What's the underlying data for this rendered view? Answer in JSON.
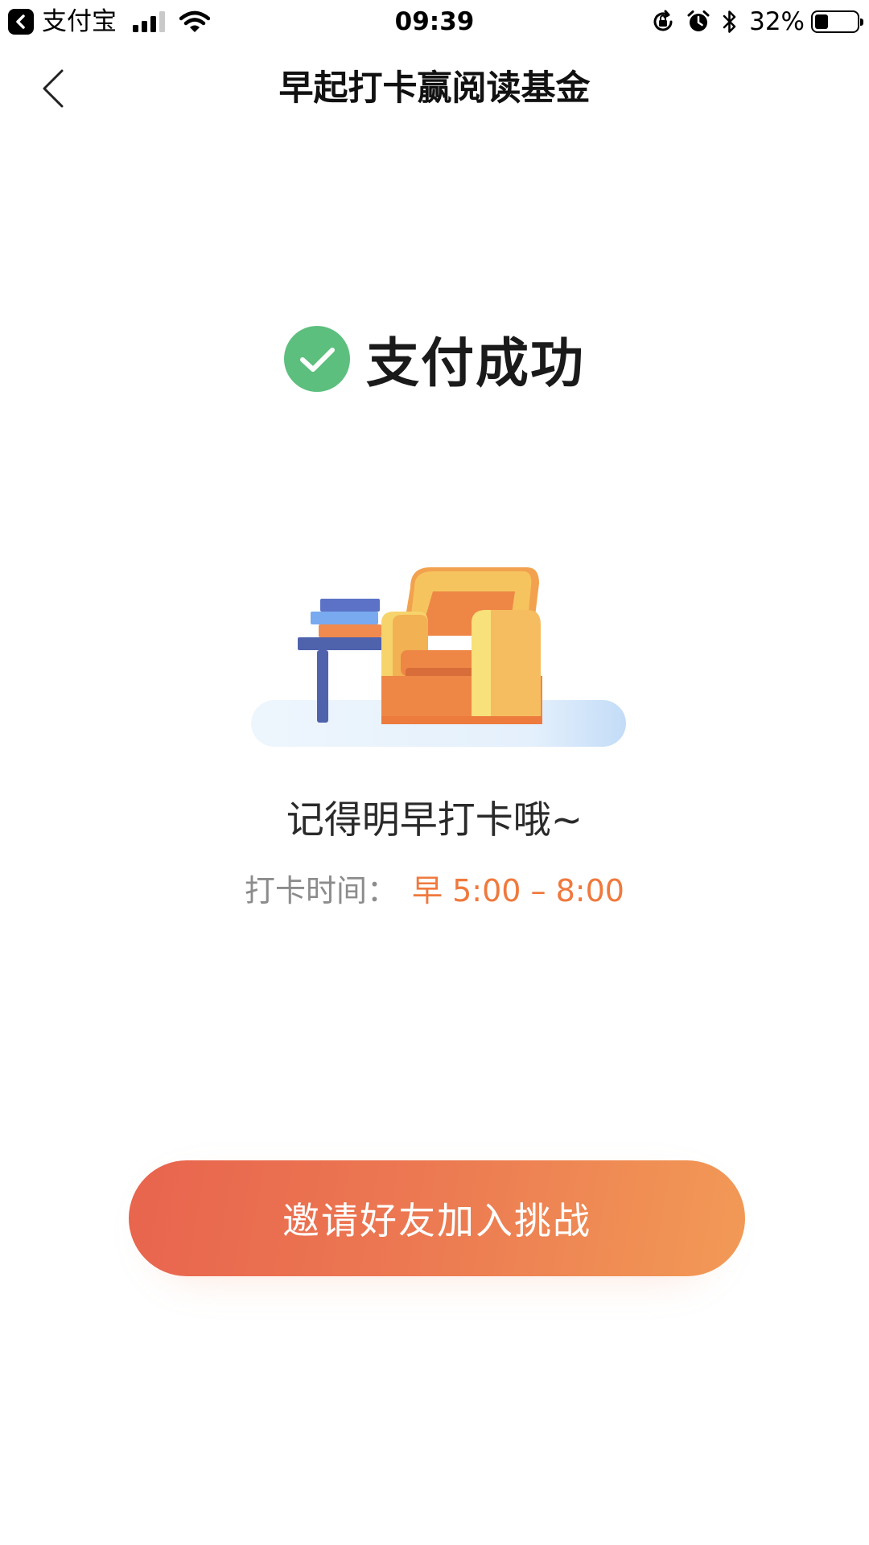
{
  "status_bar": {
    "app_name": "支付宝",
    "time": "09:39",
    "battery_percent": "32%",
    "battery_level": 0.32
  },
  "nav": {
    "title": "早起打卡赢阅读基金"
  },
  "success": {
    "text": "支付成功",
    "icon": "check-circle-icon",
    "color": "#5dbf7e"
  },
  "reminder": {
    "text": "记得明早打卡哦~",
    "checkin_label": "打卡时间：",
    "checkin_time": "早 5:00 – 8:00"
  },
  "cta": {
    "label": "邀请好友加入挑战"
  },
  "colors": {
    "accent": "#f0793d",
    "cta_gradient_start": "#e8644e",
    "cta_gradient_end": "#f29a56",
    "muted_text": "#8c8c8c"
  }
}
